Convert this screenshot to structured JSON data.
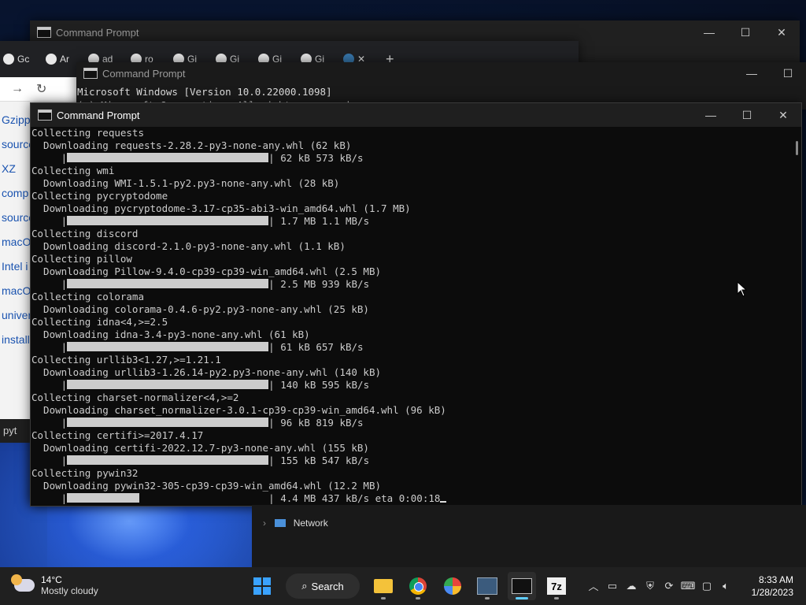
{
  "windows": {
    "back1_title": "Command Prompt",
    "back2_title": "Command Prompt",
    "back2_lines": [
      "Microsoft Windows [Version 10.0.22000.1098]",
      "(c) Microsoft Corporation. All rights reserved."
    ],
    "main_title": "Command Prompt"
  },
  "browser": {
    "tabs": [
      "Gc",
      "Ar",
      "ad",
      "ro",
      "Gi",
      "Gi",
      "Gi",
      "Gi",
      ""
    ],
    "links": [
      "Gzipp",
      "source",
      "XZ",
      "comp",
      "source",
      "macO",
      "Intel i",
      "macO",
      "univer",
      "install"
    ],
    "status": "pyt"
  },
  "console": {
    "lines": [
      {
        "type": "text",
        "text": "Collecting requests"
      },
      {
        "type": "text",
        "text": "  Downloading requests-2.28.2-py3-none-any.whl (62 kB)"
      },
      {
        "type": "bar",
        "fill": 1.0,
        "text": " 62 kB 573 kB/s"
      },
      {
        "type": "text",
        "text": "Collecting wmi"
      },
      {
        "type": "text",
        "text": "  Downloading WMI-1.5.1-py2.py3-none-any.whl (28 kB)"
      },
      {
        "type": "text",
        "text": "Collecting pycryptodome"
      },
      {
        "type": "text",
        "text": "  Downloading pycryptodome-3.17-cp35-abi3-win_amd64.whl (1.7 MB)"
      },
      {
        "type": "bar",
        "fill": 1.0,
        "text": " 1.7 MB 1.1 MB/s"
      },
      {
        "type": "text",
        "text": "Collecting discord"
      },
      {
        "type": "text",
        "text": "  Downloading discord-2.1.0-py3-none-any.whl (1.1 kB)"
      },
      {
        "type": "text",
        "text": "Collecting pillow"
      },
      {
        "type": "text",
        "text": "  Downloading Pillow-9.4.0-cp39-cp39-win_amd64.whl (2.5 MB)"
      },
      {
        "type": "bar",
        "fill": 1.0,
        "text": " 2.5 MB 939 kB/s"
      },
      {
        "type": "text",
        "text": "Collecting colorama"
      },
      {
        "type": "text",
        "text": "  Downloading colorama-0.4.6-py2.py3-none-any.whl (25 kB)"
      },
      {
        "type": "text",
        "text": "Collecting idna<4,>=2.5"
      },
      {
        "type": "text",
        "text": "  Downloading idna-3.4-py3-none-any.whl (61 kB)"
      },
      {
        "type": "bar",
        "fill": 1.0,
        "text": " 61 kB 657 kB/s"
      },
      {
        "type": "text",
        "text": "Collecting urllib3<1.27,>=1.21.1"
      },
      {
        "type": "text",
        "text": "  Downloading urllib3-1.26.14-py2.py3-none-any.whl (140 kB)"
      },
      {
        "type": "bar",
        "fill": 1.0,
        "text": " 140 kB 595 kB/s"
      },
      {
        "type": "text",
        "text": "Collecting charset-normalizer<4,>=2"
      },
      {
        "type": "text",
        "text": "  Downloading charset_normalizer-3.0.1-cp39-cp39-win_amd64.whl (96 kB)"
      },
      {
        "type": "bar",
        "fill": 1.0,
        "text": " 96 kB 819 kB/s"
      },
      {
        "type": "text",
        "text": "Collecting certifi>=2017.4.17"
      },
      {
        "type": "text",
        "text": "  Downloading certifi-2022.12.7-py3-none-any.whl (155 kB)"
      },
      {
        "type": "bar",
        "fill": 1.0,
        "text": " 155 kB 547 kB/s"
      },
      {
        "type": "text",
        "text": "Collecting pywin32"
      },
      {
        "type": "text",
        "text": "  Downloading pywin32-305-cp39-cp39-win_amd64.whl (12.2 MB)"
      },
      {
        "type": "bar",
        "fill": 0.36,
        "text": " 4.4 MB 437 kB/s eta 0:00:18",
        "cursor": true
      }
    ]
  },
  "explorer": {
    "network_label": "Network"
  },
  "taskbar": {
    "weather_temp": "14°C",
    "weather_desc": "Mostly cloudy",
    "search_label": "Search",
    "time": "8:33 AM",
    "date": "1/28/2023",
    "apps": [
      "start-icon",
      "search",
      "file-explorer-icon",
      "chrome-icon",
      "brave-icon",
      "performance-monitor-icon",
      "terminal-icon",
      "7zip-icon"
    ],
    "zip_label": "7z"
  },
  "colors": {
    "console_bg": "#0c0c0c",
    "console_fg": "#cccccc",
    "taskbar_bg": "#202020",
    "accent": "#60cdff"
  }
}
